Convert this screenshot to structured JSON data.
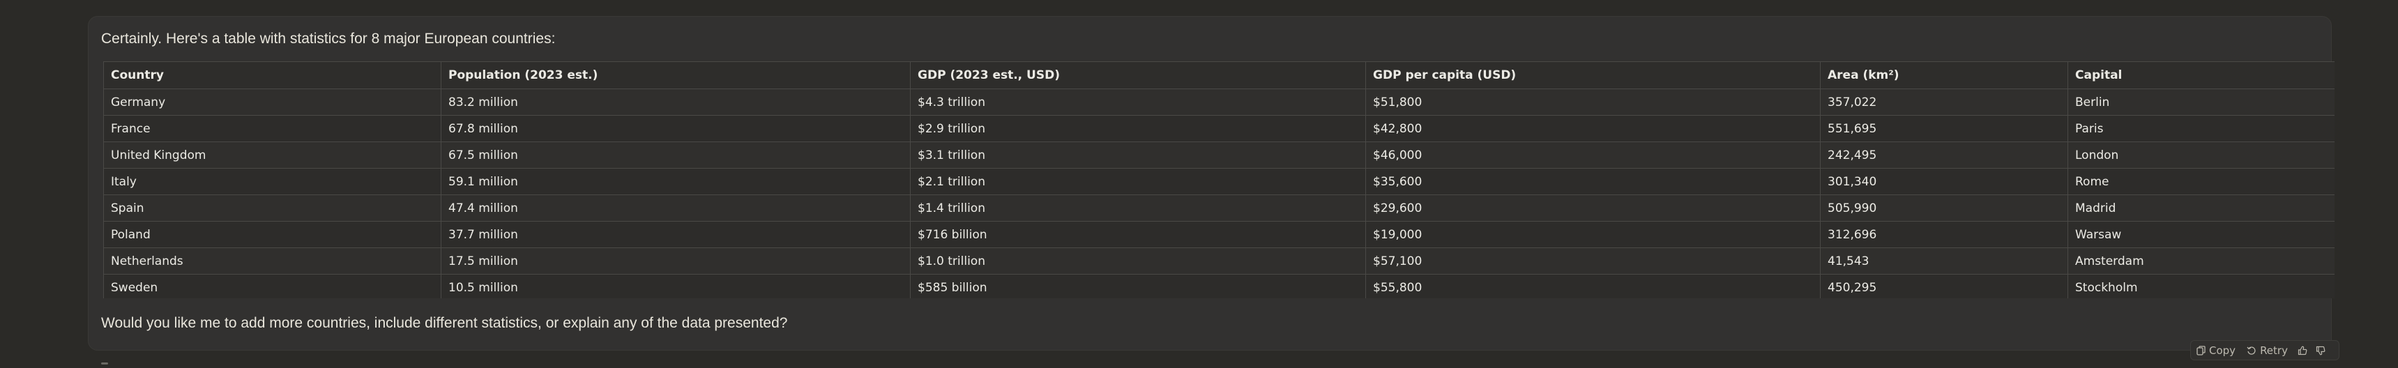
{
  "message": {
    "intro": "Certainly. Here's a table with statistics for 8 major European countries:",
    "outro": "Would you like me to add more countries, include different statistics, or explain any of the data presented?"
  },
  "table": {
    "headers": [
      "Country",
      "Population (2023 est.)",
      "GDP (2023 est., USD)",
      "GDP per capita (USD)",
      "Area (km²)",
      "Capital"
    ],
    "rows": [
      [
        "Germany",
        "83.2 million",
        "$4.3 trillion",
        "$51,800",
        "357,022",
        "Berlin"
      ],
      [
        "France",
        "67.8 million",
        "$2.9 trillion",
        "$42,800",
        "551,695",
        "Paris"
      ],
      [
        "United Kingdom",
        "67.5 million",
        "$3.1 trillion",
        "$46,000",
        "242,495",
        "London"
      ],
      [
        "Italy",
        "59.1 million",
        "$2.1 trillion",
        "$35,600",
        "301,340",
        "Rome"
      ],
      [
        "Spain",
        "47.4 million",
        "$1.4 trillion",
        "$29,600",
        "505,990",
        "Madrid"
      ],
      [
        "Poland",
        "37.7 million",
        "$716 billion",
        "$19,000",
        "312,696",
        "Warsaw"
      ],
      [
        "Netherlands",
        "17.5 million",
        "$1.0 trillion",
        "$57,100",
        "41,543",
        "Amsterdam"
      ],
      [
        "Sweden",
        "10.5 million",
        "$585 billion",
        "$55,800",
        "450,295",
        "Stockholm"
      ]
    ]
  },
  "actions": {
    "copy_label": "Copy",
    "retry_label": "Retry",
    "copy_icon": "copy-icon",
    "retry_icon": "retry-icon",
    "thumbs_up_icon": "thumbs-up-icon",
    "thumbs_down_icon": "thumbs-down-icon"
  }
}
